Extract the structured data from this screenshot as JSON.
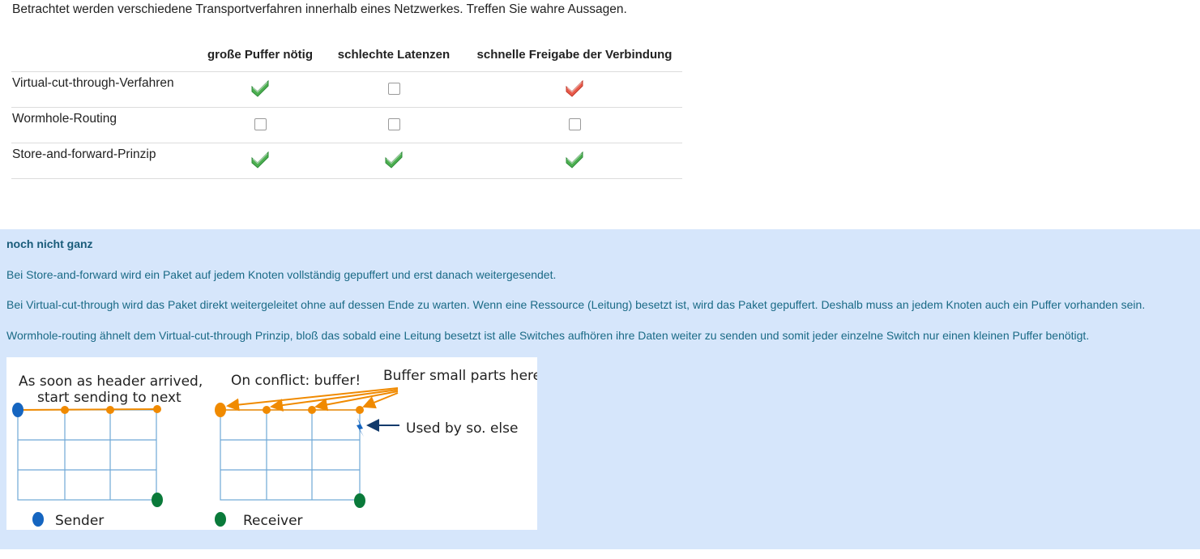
{
  "question": "Betrachtet werden verschiedene Transportverfahren innerhalb eines Netzwerkes. Treffen Sie wahre Aussagen.",
  "columns": [
    "große Puffer nötig",
    "schlechte Latenzen",
    "schnelle Freigabe der Verbindung"
  ],
  "rows": [
    {
      "label": "Virtual-cut-through-Verfahren",
      "cells": [
        "check-green",
        "empty",
        "check-red"
      ]
    },
    {
      "label": "Wormhole-Routing",
      "cells": [
        "empty",
        "empty",
        "empty"
      ]
    },
    {
      "label": "Store-and-forward-Prinzip",
      "cells": [
        "check-green",
        "check-green",
        "check-green"
      ]
    }
  ],
  "colors": {
    "green": "#4caf50",
    "red": "#e85a4a",
    "feedback_bg": "#d6e6fb",
    "feedback_text": "#1a6a86"
  },
  "feedback": {
    "title": "noch nicht ganz",
    "lines": [
      "Bei Store-and-forward wird ein Paket auf jedem Knoten vollständig gepuffert und erst danach weitergesendet.",
      "Bei Virtual-cut-through wird das Paket direkt weitergeleitet ohne auf dessen Ende zu warten. Wenn eine Ressource (Leitung) besetzt ist, wird das Paket gepuffert. Deshalb muss an jedem Knoten auch ein Puffer vorhanden sein.",
      "Wormhole-routing ähnelt dem Virtual-cut-through Prinzip, bloß das sobald eine Leitung besetzt ist alle Switches aufhören ihre Daten weiter zu senden und somit jeder einzelne Switch nur einen kleinen Puffer benötigt."
    ]
  },
  "diagram": {
    "label_left_1": "As soon as header arrived,",
    "label_left_2": "start sending to next",
    "label_conflict": "On conflict: buffer!",
    "label_buffer": "Buffer small parts here",
    "label_used": "Used by so. else",
    "legend_sender": "Sender",
    "legend_receiver": "Receiver"
  }
}
